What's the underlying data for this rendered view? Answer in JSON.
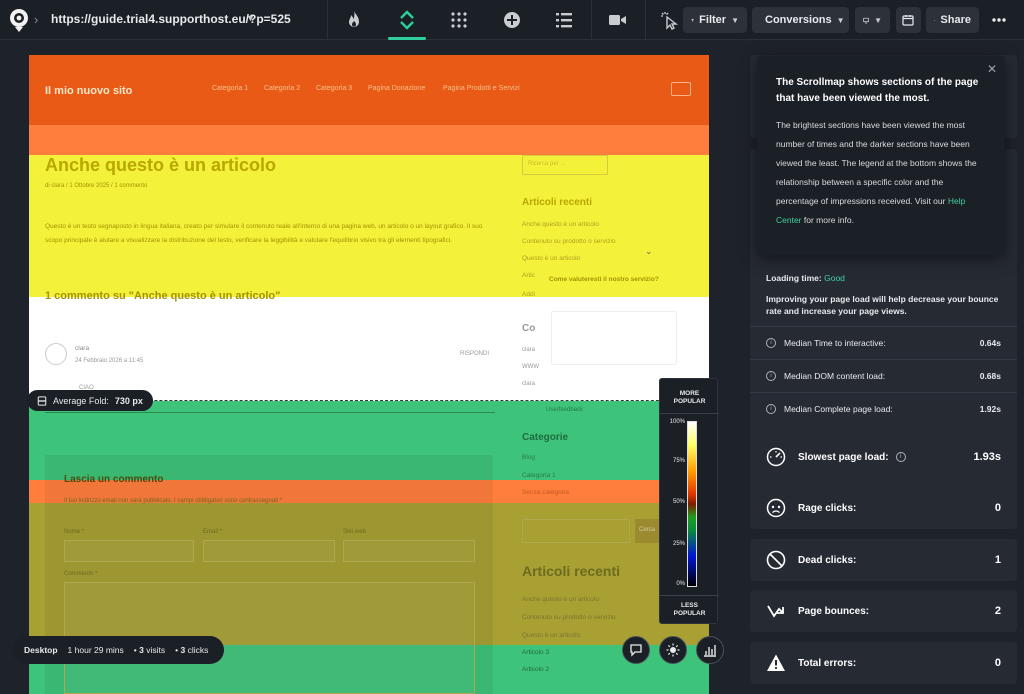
{
  "topbar": {
    "url": "https://guide.trial4.supporthost.eu/?p=525",
    "filter_label": "Filter",
    "conversions_label": "Conversions",
    "share_label": "Share"
  },
  "site": {
    "title": "Il mio nuovo sito",
    "nav": [
      "Categoria 1",
      "Categoria 2",
      "Categoria 3",
      "Pagina Donazione",
      "Pagina Prodotti e Servizi"
    ],
    "article_title": "Anche questo è un articolo",
    "meta": "di clara  /  1 Ottobre 2025  /  1 commento",
    "paragraph_a": "Questo è un testo segnaposto in lingua italiana, creato per simulare il contenuto reale all'interno di una pagina web, un articolo o un layout grafico. Il suo scopo principale è aiutare a visualizzare la distribuzione del testo, verificare la leggibilità e valutare l'equilibrio visivo tra gli elementi tipografici.",
    "search_placeholder": "Ricerca per ...",
    "recent_heading": "Articoli recenti",
    "recent_links": [
      "Anche questo è un articolo",
      "Contenuto su prodotto o servizio",
      "Questo è un articolo",
      "Artic",
      "Addi"
    ],
    "comments_heading": "1 commento su \"Anche questo è un articolo\"",
    "commenter": "clara",
    "comment_date": "24 Febbraio 2026 a 11:45",
    "reply": "RISPONDI",
    "side_comments_heading": "Co",
    "side_comment_links": [
      "clara",
      "WWW",
      "clara"
    ],
    "ciao": "CIAO",
    "feedback_question": "Come valuteresti il nostro servizio?",
    "feedback_brand": "Userfeedback",
    "categories_heading": "Categorie",
    "categories": [
      "Blog",
      "Categoria 1",
      "Senza categoria"
    ],
    "leave_heading": "Lascia un commento",
    "leave_note": "Il tuo indirizzo email non sarà pubblicato. I campi obbligatori sono contrassegnati *",
    "name_label": "Nome *",
    "email_label": "Email *",
    "site_label": "Sito web",
    "comment_label": "Commento *",
    "cerca_label": "Cerca",
    "recent_heading_2": "Articoli recenti",
    "recent_links_2": [
      "Anche questo è un articolo",
      "Contenuto su prodotto o servizio",
      "Questo è un articolo",
      "Articolo 3",
      "Articolo 2"
    ]
  },
  "fold": {
    "label": "Average Fold:",
    "value": "730 px"
  },
  "legend": {
    "top": "MORE\nPOPULAR",
    "bottom": "LESS\nPOPULAR",
    "ticks": [
      "100%",
      "75%",
      "50%",
      "25%",
      "0%"
    ]
  },
  "status": {
    "device": "Desktop",
    "duration": "1 hour 29 mins",
    "visits": "3",
    "visits_label": "visits",
    "clicks": "3",
    "clicks_label": "clicks"
  },
  "tooltip": {
    "title": "The Scrollmap shows sections of the page that have been viewed the most.",
    "body_before": "The brightest sections have been viewed the most number of times and the darker sections have been viewed the least. The legend at the bottom shows the relationship between a specific color and the percentage of impressions received. Visit our ",
    "link": "Help Center",
    "body_after": " for more info."
  },
  "performance": {
    "loading_label": "Loading time:",
    "loading_value": "Good",
    "advice": "Improving your page load will help decrease your bounce rate and increase your page views.",
    "rows": [
      {
        "label": "Median Time to interactive:",
        "value": "0.64s"
      },
      {
        "label": "Median DOM content load:",
        "value": "0.68s"
      },
      {
        "label": "Median Complete page load:",
        "value": "1.92s"
      }
    ]
  },
  "metrics": [
    {
      "label": "Slowest page load:",
      "value": "1.93s",
      "icon": "speedometer-icon"
    },
    {
      "label": "Rage clicks:",
      "value": "0",
      "icon": "angry-face-icon"
    },
    {
      "label": "Dead clicks:",
      "value": "1",
      "icon": "prohibited-icon"
    },
    {
      "label": "Page bounces:",
      "value": "2",
      "icon": "bounce-arrow-icon"
    },
    {
      "label": "Total errors:",
      "value": "0",
      "icon": "warning-icon"
    }
  ],
  "colors": {
    "accent": "#2ecf9d",
    "band_orange_dark": "#ea5a17",
    "band_orange": "#ff7e3d",
    "band_yellow": "#f4f13a",
    "band_green": "#3ec47a",
    "band_olive": "#a8a033"
  }
}
